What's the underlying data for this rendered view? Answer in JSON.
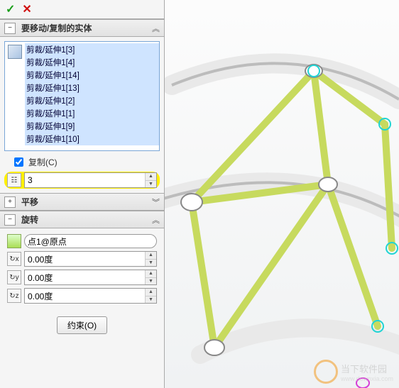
{
  "header": {},
  "bodies_section": {
    "title": "要移动/复制的实体",
    "items": [
      "剪裁/延伸1[3]",
      "剪裁/延伸1[4]",
      "剪裁/延伸1[14]",
      "剪裁/延伸1[13]",
      "剪裁/延伸1[2]",
      "剪裁/延伸1[1]",
      "剪裁/延伸1[9]",
      "剪裁/延伸1[10]"
    ],
    "copy_label": "复制(C)",
    "copy_checked": true,
    "count_value": "3"
  },
  "translate_section": {
    "title": "平移"
  },
  "rotate_section": {
    "title": "旋转",
    "reference": "点1@原点",
    "angle_x": "0.00度",
    "angle_y": "0.00度",
    "angle_z": "0.00度"
  },
  "constraint_button": "约束(O)",
  "watermark": {
    "site": "当下软件园",
    "url": "www.downxia.com"
  }
}
